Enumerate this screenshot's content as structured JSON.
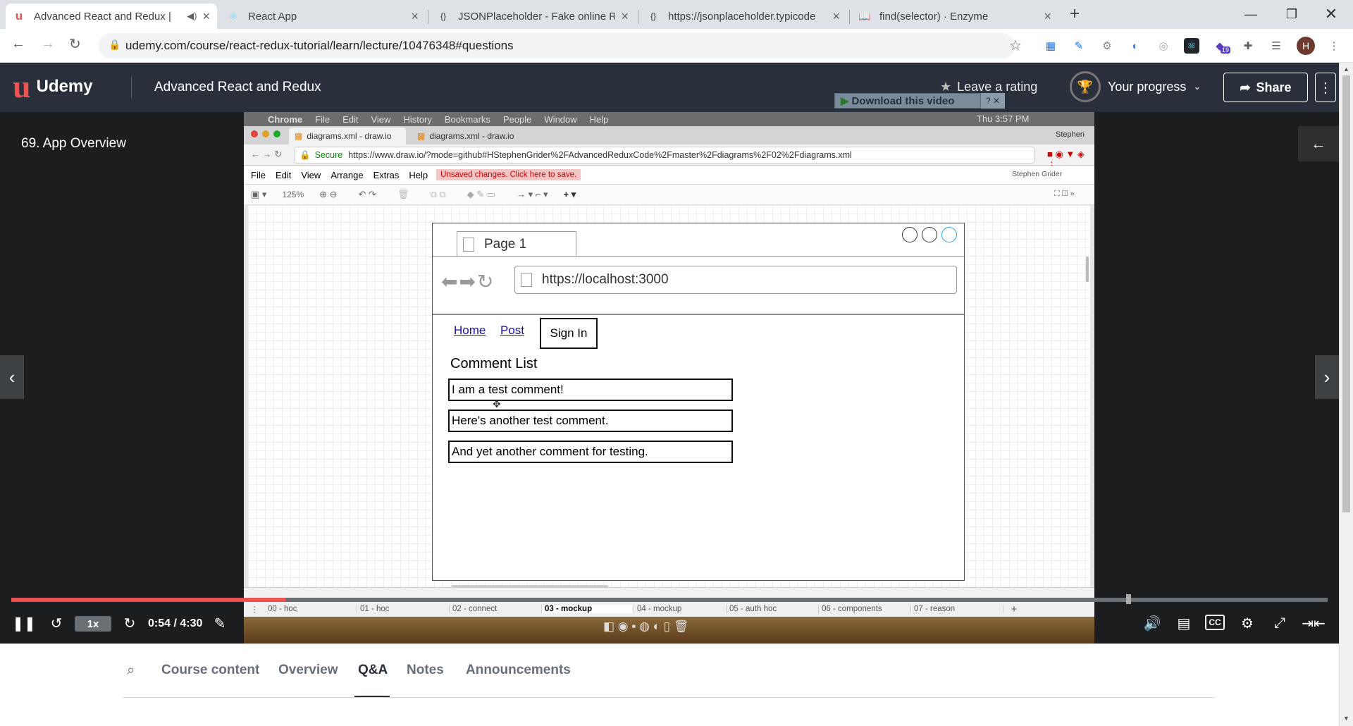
{
  "browser": {
    "tabs": [
      {
        "title": "Advanced React and Redux |",
        "icon": "udemy-favicon"
      },
      {
        "title": "React App",
        "icon": "react-favicon"
      },
      {
        "title": "JSONPlaceholder - Fake online RE",
        "icon": "jsonplaceholder-favicon"
      },
      {
        "title": "https://jsonplaceholder.typicode",
        "icon": "jsonplaceholder-favicon"
      },
      {
        "title": "find(selector) · Enzyme",
        "icon": "book-favicon"
      }
    ],
    "url": "udemy.com/course/react-redux-tutorial/learn/lecture/10476348#questions",
    "profile_initial": "H",
    "ext_badge": "19"
  },
  "udemy": {
    "logo": "Udemy",
    "course_title": "Advanced React and Redux",
    "leave_rating": "Leave a rating",
    "your_progress": "Your progress",
    "share": "Share",
    "lecture_title": "69. App Overview"
  },
  "video": {
    "download_label": "Download this video",
    "mac_menu": [
      "Chrome",
      "File",
      "Edit",
      "View",
      "History",
      "Bookmarks",
      "People",
      "Window",
      "Help"
    ],
    "mac_clock": "Thu 3:57 PM",
    "inner_tabs": [
      "diagrams.xml - draw.io",
      "diagrams.xml - draw.io"
    ],
    "inner_user": "Stephen",
    "secure_label": "Secure",
    "inner_url": "https://www.draw.io/?mode=github#HStephenGrider%2FAdvancedReduxCode%2Fmaster%2Fdiagrams%2F02%2Fdiagrams.xml",
    "drawio_menu": [
      "File",
      "Edit",
      "View",
      "Arrange",
      "Extras",
      "Help"
    ],
    "unsaved_notice": "Unsaved changes. Click here to save.",
    "drawio_user": "Stephen Grider",
    "zoom": "125%",
    "mockup": {
      "page_tab": "Page 1",
      "address": "https://localhost:3000",
      "nav_links": [
        "Home",
        "Post"
      ],
      "signin": "Sign In",
      "list_title": "Comment List",
      "comments": [
        "I am a test comment!",
        "Here's another test comment.",
        "And yet another comment for testing."
      ]
    },
    "page_tabs": [
      "00 - hoc",
      "01 - hoc",
      "02 - connect",
      "03 - mockup",
      "04 - mockup",
      "05 - auth hoc",
      "06 - components",
      "07 - reason"
    ],
    "active_page_tab": "03 - mockup"
  },
  "controls": {
    "speed": "1x",
    "time": "0:54 / 4:30",
    "progress_fraction": 0.208
  },
  "course_tabs": [
    "Course content",
    "Overview",
    "Q&A",
    "Notes",
    "Announcements"
  ],
  "active_course_tab": "Q&A",
  "colors": {
    "udemy_header": "#29303b",
    "progress_red": "#ec5252",
    "accent": "#a435f0"
  }
}
